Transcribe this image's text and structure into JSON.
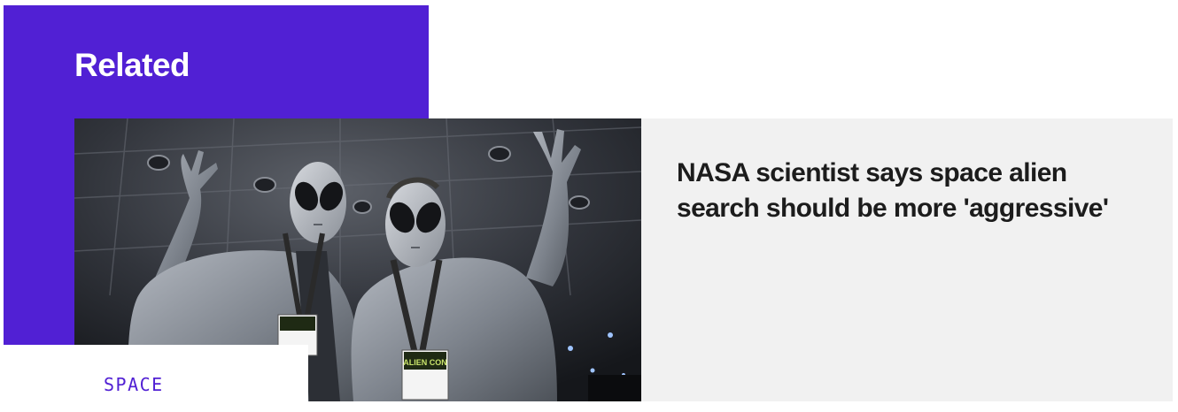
{
  "section": {
    "title": "Related",
    "accent_color": "#5120d4"
  },
  "article": {
    "headline": "NASA scientist says space alien search should be more 'aggressive'",
    "category": "SPACE",
    "image": {
      "badge_logo_text": "ALIEN CON"
    }
  },
  "colors": {
    "card_background": "#f1f1f1",
    "headline_text": "#1c1c1c",
    "tag_text": "#5120d4"
  }
}
